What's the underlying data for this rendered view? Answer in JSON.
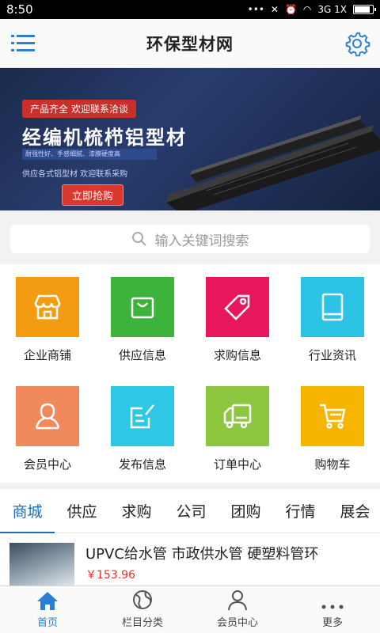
{
  "status": {
    "time": "8:50",
    "network": "3G 1X"
  },
  "header": {
    "title": "环保型材网",
    "menu_icon": "menu-icon",
    "settings_icon": "gear-icon"
  },
  "banner": {
    "tag": "产品齐全 欢迎联系洽谈",
    "headline": "经编机梳栉铝型材",
    "features": "耐强性好、手感细腻、漆膜硬度高",
    "sub": "供应各式铝型材 欢迎联系采购",
    "buy": "立即抢购"
  },
  "search": {
    "placeholder": "输入关键词搜索"
  },
  "categories": [
    {
      "label": "企业商铺",
      "color": "#f39c12",
      "icon": "shop-icon"
    },
    {
      "label": "供应信息",
      "color": "#3cb43c",
      "icon": "shopping-bag-icon"
    },
    {
      "label": "求购信息",
      "color": "#e8175d",
      "icon": "price-tag-icon"
    },
    {
      "label": "行业资讯",
      "color": "#2cc3e4",
      "icon": "tablet-icon"
    },
    {
      "label": "会员中心",
      "color": "#f08a5d",
      "icon": "user-icon"
    },
    {
      "label": "发布信息",
      "color": "#2ec8e6",
      "icon": "edit-icon"
    },
    {
      "label": "订单中心",
      "color": "#8dc63f",
      "icon": "truck-icon"
    },
    {
      "label": "购物车",
      "color": "#f7b500",
      "icon": "cart-icon"
    }
  ],
  "tabs": [
    "商城",
    "供应",
    "求购",
    "公司",
    "团购",
    "行情",
    "展会"
  ],
  "product": {
    "name": "UPVC给水管 市政供水管 硬塑料管环",
    "price": "￥153.96"
  },
  "bottom_nav": [
    {
      "label": "首页",
      "icon": "home-icon"
    },
    {
      "label": "栏目分类",
      "icon": "globe-icon"
    },
    {
      "label": "会员中心",
      "icon": "user-icon"
    },
    {
      "label": "更多",
      "icon": "more-icon"
    }
  ],
  "colors": {
    "accent": "#1f6fc0",
    "price": "#e0342b"
  }
}
